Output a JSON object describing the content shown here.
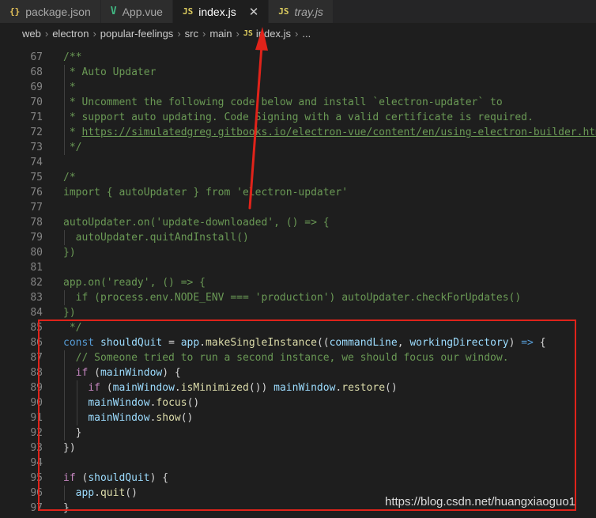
{
  "tabs": [
    {
      "label": "package.json",
      "icon": "json-icon",
      "icon_text": "{}",
      "active": false
    },
    {
      "label": "App.vue",
      "icon": "vue-icon",
      "icon_text": "V",
      "active": false
    },
    {
      "label": "index.js",
      "icon": "js-icon",
      "icon_text": "JS",
      "active": true,
      "close": "✕"
    },
    {
      "label": "tray.js",
      "icon": "js-icon",
      "icon_text": "JS",
      "active": false,
      "italic": true
    }
  ],
  "breadcrumb": {
    "items": [
      "web",
      "electron",
      "popular-feelings",
      "src",
      "main"
    ],
    "file_icon": "JS",
    "file": "index.js",
    "more": "...",
    "separator": "›"
  },
  "editor": {
    "lines": [
      {
        "n": "67",
        "t": [
          [
            "c",
            "/**"
          ]
        ]
      },
      {
        "n": "68",
        "t": [
          [
            "c",
            " * Auto Updater"
          ]
        ]
      },
      {
        "n": "69",
        "t": [
          [
            "c",
            " *"
          ]
        ]
      },
      {
        "n": "70",
        "t": [
          [
            "c",
            " * Uncomment the following code below and install `electron-updater` to"
          ]
        ]
      },
      {
        "n": "71",
        "t": [
          [
            "c",
            " * support auto updating. Code Signing with a valid certificate is required."
          ]
        ]
      },
      {
        "n": "72",
        "t": [
          [
            "c",
            " * "
          ],
          [
            "u",
            "https://simulatedgreg.gitbooks.io/electron-vue/content/en/using-electron-builder.html"
          ]
        ]
      },
      {
        "n": "73",
        "t": [
          [
            "c",
            " */"
          ]
        ]
      },
      {
        "n": "74",
        "t": []
      },
      {
        "n": "75",
        "t": [
          [
            "c",
            "/*"
          ]
        ]
      },
      {
        "n": "76",
        "t": [
          [
            "c",
            "import { autoUpdater } from 'electron-updater'"
          ]
        ]
      },
      {
        "n": "77",
        "t": []
      },
      {
        "n": "78",
        "t": [
          [
            "c",
            "autoUpdater.on('update-downloaded', () => {"
          ]
        ]
      },
      {
        "n": "79",
        "t": [
          [
            "c",
            "  autoUpdater.quitAndInstall()"
          ]
        ]
      },
      {
        "n": "80",
        "t": [
          [
            "c",
            "})"
          ]
        ]
      },
      {
        "n": "81",
        "t": []
      },
      {
        "n": "82",
        "t": [
          [
            "c",
            "app.on('ready', () => {"
          ]
        ]
      },
      {
        "n": "83",
        "t": [
          [
            "c",
            "  if (process.env.NODE_ENV === 'production') autoUpdater.checkForUpdates()"
          ]
        ]
      },
      {
        "n": "84",
        "t": [
          [
            "c",
            "})"
          ]
        ]
      },
      {
        "n": "85",
        "t": [
          [
            "c",
            " */"
          ]
        ]
      },
      {
        "n": "86",
        "t": [
          [
            "k",
            "const"
          ],
          [
            "p",
            " "
          ],
          [
            "v",
            "shouldQuit"
          ],
          [
            "p",
            " = "
          ],
          [
            "v",
            "app"
          ],
          [
            "p",
            "."
          ],
          [
            "f",
            "makeSingleInstance"
          ],
          [
            "p",
            "(("
          ],
          [
            "v",
            "commandLine"
          ],
          [
            "p",
            ", "
          ],
          [
            "v",
            "workingDirectory"
          ],
          [
            "p",
            ") "
          ],
          [
            "k",
            "=>"
          ],
          [
            "p",
            " {"
          ]
        ]
      },
      {
        "n": "87",
        "t": [
          [
            "p",
            "  "
          ],
          [
            "c",
            "// Someone tried to run a second instance, we should focus our window."
          ]
        ]
      },
      {
        "n": "88",
        "t": [
          [
            "p",
            "  "
          ],
          [
            "ctl",
            "if"
          ],
          [
            "p",
            " ("
          ],
          [
            "v",
            "mainWindow"
          ],
          [
            "p",
            ") {"
          ]
        ]
      },
      {
        "n": "89",
        "t": [
          [
            "p",
            "    "
          ],
          [
            "ctl",
            "if"
          ],
          [
            "p",
            " ("
          ],
          [
            "v",
            "mainWindow"
          ],
          [
            "p",
            "."
          ],
          [
            "f",
            "isMinimized"
          ],
          [
            "p",
            "()) "
          ],
          [
            "v",
            "mainWindow"
          ],
          [
            "p",
            "."
          ],
          [
            "f",
            "restore"
          ],
          [
            "p",
            "()"
          ]
        ]
      },
      {
        "n": "90",
        "t": [
          [
            "p",
            "    "
          ],
          [
            "v",
            "mainWindow"
          ],
          [
            "p",
            "."
          ],
          [
            "f",
            "focus"
          ],
          [
            "p",
            "()"
          ]
        ]
      },
      {
        "n": "91",
        "t": [
          [
            "p",
            "    "
          ],
          [
            "v",
            "mainWindow"
          ],
          [
            "p",
            "."
          ],
          [
            "f",
            "show"
          ],
          [
            "p",
            "()"
          ]
        ]
      },
      {
        "n": "92",
        "t": [
          [
            "p",
            "  }"
          ]
        ]
      },
      {
        "n": "93",
        "t": [
          [
            "p",
            "})"
          ]
        ]
      },
      {
        "n": "94",
        "t": []
      },
      {
        "n": "95",
        "t": [
          [
            "ctl",
            "if"
          ],
          [
            "p",
            " ("
          ],
          [
            "v",
            "shouldQuit"
          ],
          [
            "p",
            ") {"
          ]
        ]
      },
      {
        "n": "96",
        "t": [
          [
            "p",
            "  "
          ],
          [
            "v",
            "app"
          ],
          [
            "p",
            "."
          ],
          [
            "f",
            "quit"
          ],
          [
            "p",
            "()"
          ]
        ]
      },
      {
        "n": "97",
        "t": [
          [
            "p",
            "}"
          ]
        ]
      }
    ]
  },
  "annotations": {
    "highlight_color": "#e0231a",
    "watermark": "https://blog.csdn.net/huangxiaoguo1"
  }
}
